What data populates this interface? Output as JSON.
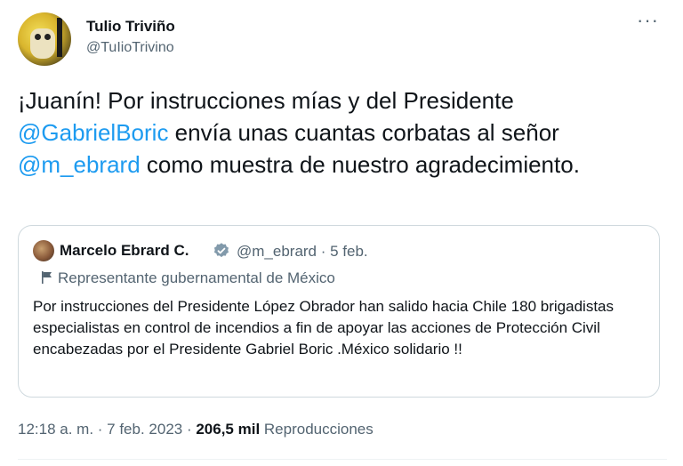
{
  "author": {
    "name": "Tulio Triviño",
    "handle": "@TuIioTrivino"
  },
  "tweet": {
    "line1": "¡Juanín! Por instrucciones mías y del Presidente",
    "mention1": "@GabrielBoric",
    "line2": " envía unas cuantas corbatas al señor",
    "mention2": "@m_ebrard",
    "line3": "  como muestra de nuestro agradecimiento."
  },
  "quote": {
    "name": "Marcelo Ebrard C.",
    "handle_date": "@m_ebrard · 5 feb.",
    "label": "Representante gubernamental de México",
    "text": "Por instrucciones del Presidente López Obrador han salido hacia Chile 180 brigadistas especialistas en control de incendios a fin de apoyar las acciones de Protección Civil encabezadas por el Presidente Gabriel Boric .México solidario !!"
  },
  "meta": {
    "time_date": "12:18 a. m. · 7 feb. 2023 · ",
    "views": "206,5 mil",
    "views_label": " Reproducciones"
  },
  "colors": {
    "accent": "#1d9bf0",
    "text": "#0f1419",
    "secondary": "#536471",
    "border": "#cfd9de"
  },
  "icons": [
    "more-icon",
    "verified-icon",
    "flag-icon"
  ]
}
